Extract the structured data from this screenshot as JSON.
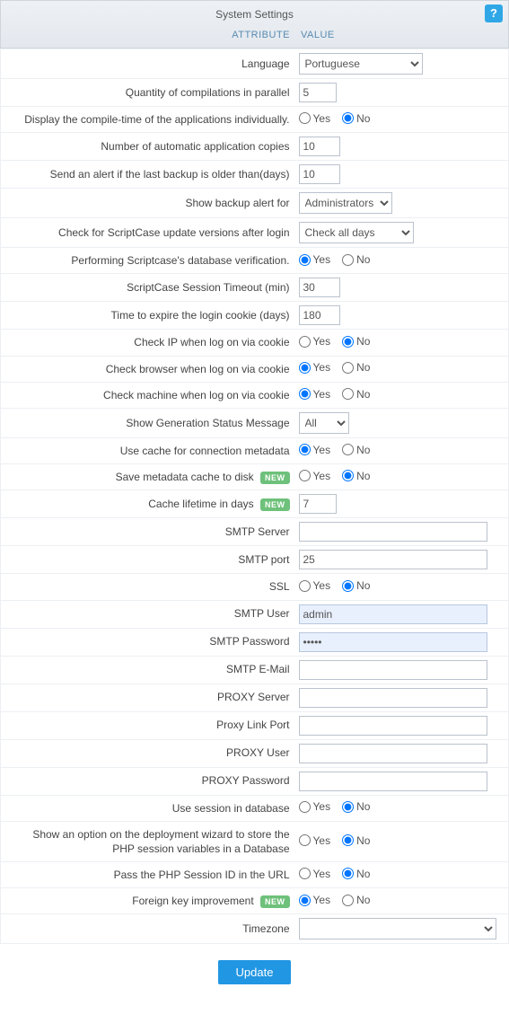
{
  "header": {
    "title": "System Settings",
    "help_icon": "?",
    "col_attribute": "ATTRIBUTE",
    "col_value": "VALUE"
  },
  "labels": {
    "language": "Language",
    "compilations": "Quantity of compilations in parallel",
    "compile_time": "Display the compile-time of the applications individually.",
    "auto_copies": "Number of automatic application copies",
    "backup_alert_days": "Send an alert if the last backup is older than(days)",
    "show_backup_for": "Show backup alert for",
    "check_update": "Check for ScriptCase update versions after login",
    "db_verification": "Performing Scriptcase's database verification.",
    "session_timeout": "ScriptCase Session Timeout (min)",
    "login_cookie_expire": "Time to expire the login cookie (days)",
    "check_ip": "Check IP when log on via cookie",
    "check_browser": "Check browser when log on via cookie",
    "check_machine": "Check machine when log on via cookie",
    "gen_status": "Show Generation Status Message",
    "cache_conn": "Use cache for connection metadata",
    "save_cache_disk": "Save metadata cache to disk",
    "cache_lifetime": "Cache lifetime in days",
    "smtp_server": "SMTP Server",
    "smtp_port": "SMTP port",
    "ssl": "SSL",
    "smtp_user": "SMTP User",
    "smtp_password": "SMTP Password",
    "smtp_email": "SMTP E-Mail",
    "proxy_server": "PROXY Server",
    "proxy_link_port": "Proxy Link Port",
    "proxy_user": "PROXY User",
    "proxy_password": "PROXY Password",
    "session_db": "Use session in database",
    "deploy_option": "Show an option on the deployment wizard to store the PHP session variables in a Database",
    "pass_session_id": "Pass the PHP Session ID in the URL",
    "fk_improvement": "Foreign key improvement",
    "timezone": "Timezone"
  },
  "values": {
    "language": "Portuguese",
    "compilations": "5",
    "compile_time": "No",
    "auto_copies": "10",
    "backup_alert_days": "10",
    "show_backup_for": "Administrators",
    "check_update": "Check all days",
    "db_verification": "Yes",
    "session_timeout": "30",
    "login_cookie_expire": "180",
    "check_ip": "No",
    "check_browser": "Yes",
    "check_machine": "Yes",
    "gen_status": "All",
    "cache_conn": "Yes",
    "save_cache_disk": "No",
    "cache_lifetime": "7",
    "smtp_server": "",
    "smtp_port": "25",
    "ssl": "No",
    "smtp_user": "admin",
    "smtp_password": "•••••",
    "smtp_email": "",
    "proxy_server": "",
    "proxy_link_port": "",
    "proxy_user": "",
    "proxy_password": "",
    "session_db": "No",
    "deploy_option": "No",
    "pass_session_id": "No",
    "fk_improvement": "Yes",
    "timezone": ""
  },
  "options": {
    "yes": "Yes",
    "no": "No",
    "new_badge": "NEW"
  },
  "footer": {
    "update": "Update"
  }
}
